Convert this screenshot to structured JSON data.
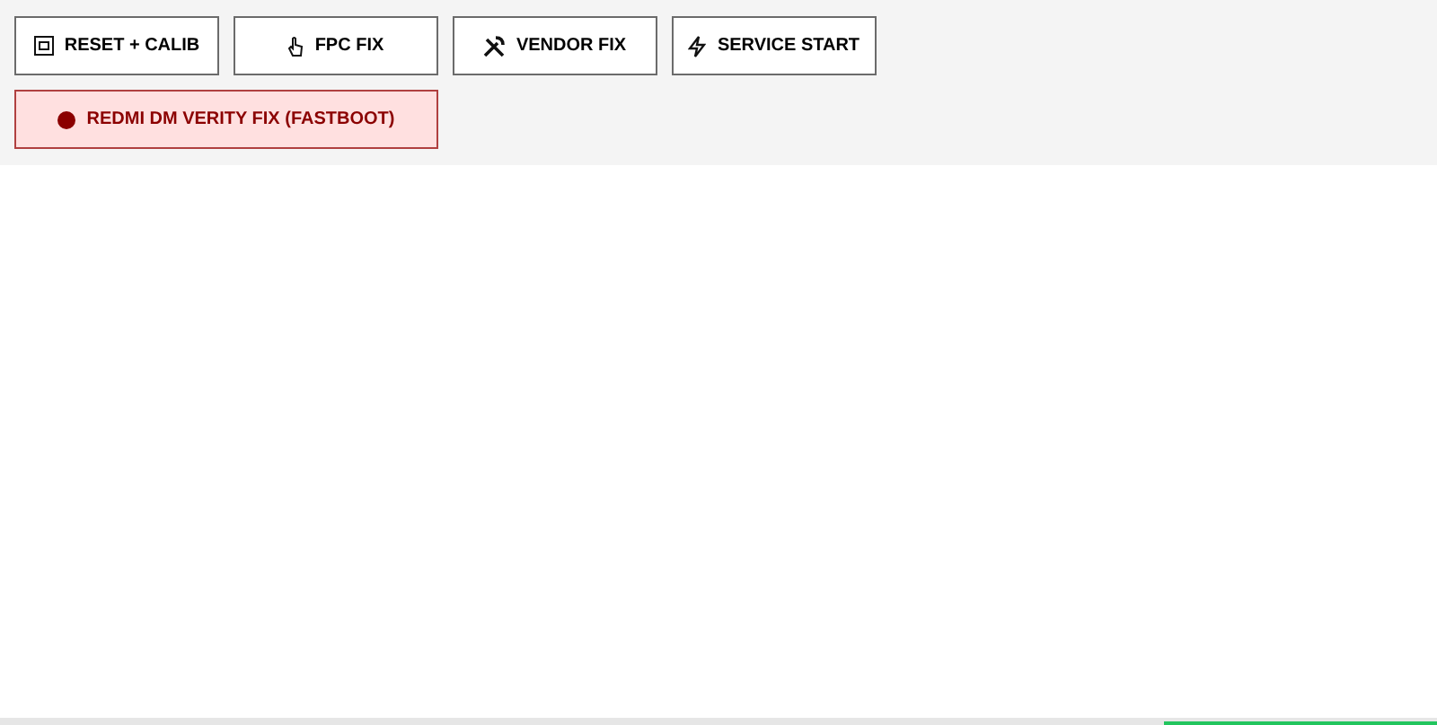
{
  "buttons": [
    {
      "label": "RESET + CALIB",
      "kind": "normal"
    },
    {
      "label": "FPC FIX",
      "kind": "normal"
    },
    {
      "label": "VENDOR FIX",
      "kind": "normal"
    },
    {
      "label": "SERVICE START",
      "kind": "normal"
    },
    {
      "label": "REDMI DM VERITY FIX (FASTBOOT)",
      "kind": "danger"
    }
  ],
  "progress": {
    "level": 0.19
  }
}
